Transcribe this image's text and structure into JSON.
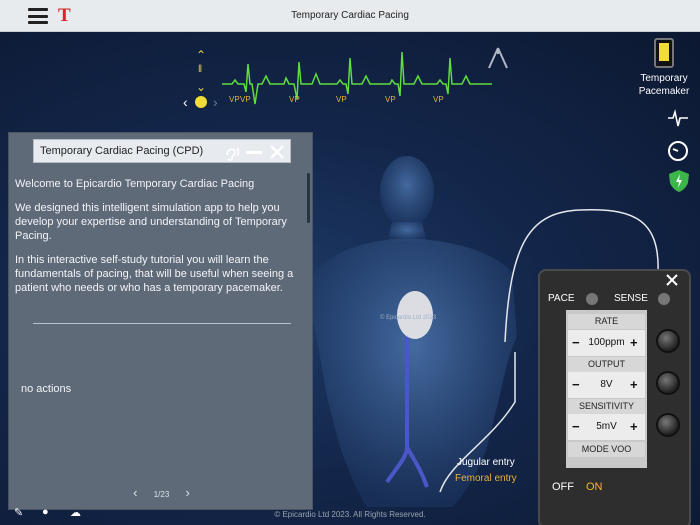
{
  "app": {
    "title": "Temporary Cardiac Pacing",
    "logo_letter": "T"
  },
  "ecg": {
    "labels": [
      "VP",
      "VP",
      "VP",
      "VP",
      "VP",
      "VP"
    ],
    "color": "#5fdc3e",
    "label_color": "#e7b33a"
  },
  "dialog": {
    "title": "Temporary Cardiac Pacing (CPD)",
    "paragraphs": [
      "Welcome to Epicardio Temporary Cardiac Pacing",
      "We designed this intelligent simulation app to help you develop your expertise and understanding of Temporary Pacing.",
      "In this interactive self-study tutorial you will learn the fundamentals of pacing, that will be useful when seeing a patient who needs or who has a temporary pacemaker."
    ],
    "no_actions": "no actions",
    "pager": "1/23"
  },
  "sidebar": {
    "pacemaker_label_1": "Temporary",
    "pacemaker_label_2": "Pacemaker"
  },
  "body_labels": {
    "jugular": "Jugular entry",
    "femoral": "Femoral entry",
    "watermark": "© Epicardio Ltd 2023"
  },
  "device": {
    "pace": "PACE",
    "sense": "SENSE",
    "rate_label": "RATE",
    "rate_value": "100ppm",
    "output_label": "OUTPUT",
    "output_value": "8V",
    "sensitivity_label": "SENSITIVITY",
    "sensitivity_value": "5mV",
    "mode_label": "MODE VOO",
    "off": "OFF",
    "on": "ON",
    "on_color": "#f0b92c"
  },
  "footer": "© Epicardio Ltd 2023. All Rights Reserved."
}
